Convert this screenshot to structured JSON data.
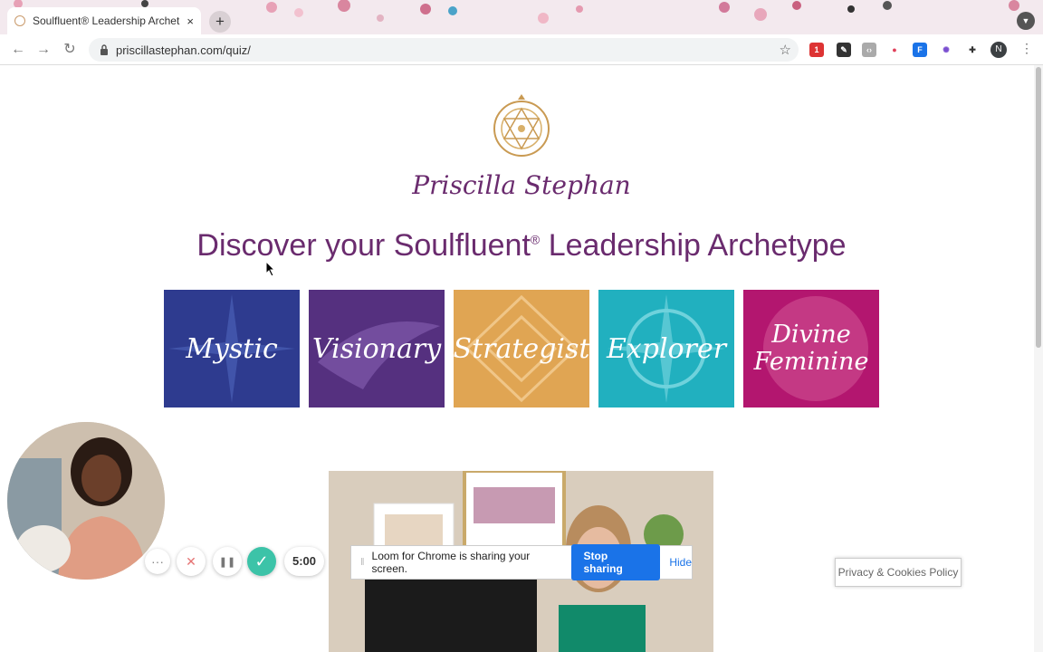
{
  "browser": {
    "tab_title": "Soulfluent® Leadership Archet",
    "tab_close": "×",
    "new_tab": "+",
    "url": "priscillastephan.com/quiz/",
    "profile_initial": "N",
    "ext_badge": "1"
  },
  "site": {
    "brand_name": "Priscilla Stephan",
    "headline_before": "Discover your Soulfluent",
    "headline_reg": "®",
    "headline_after": " Leadership Archetype"
  },
  "archetypes": [
    {
      "label": "Mystic",
      "color": "#2e3b8f"
    },
    {
      "label": "Visionary",
      "color": "#55307f"
    },
    {
      "label": "Strategist",
      "color": "#e0a553"
    },
    {
      "label": "Explorer",
      "color": "#21b0bf"
    },
    {
      "label": "Divine Feminine",
      "color": "#b3166f"
    }
  ],
  "recorder": {
    "more": "···",
    "cancel": "✕",
    "pause": "❚❚",
    "done": "✓",
    "timer": "5:00"
  },
  "loom": {
    "message": "Loom for Chrome is sharing your screen.",
    "stop_label": "Stop sharing",
    "hide_label": "Hide"
  },
  "privacy_label": "Privacy & Cookies Policy",
  "colors": {
    "brand_purple": "#6a2b6e",
    "loom_blue": "#1a73e8",
    "recorder_green": "#3cc3a8"
  }
}
